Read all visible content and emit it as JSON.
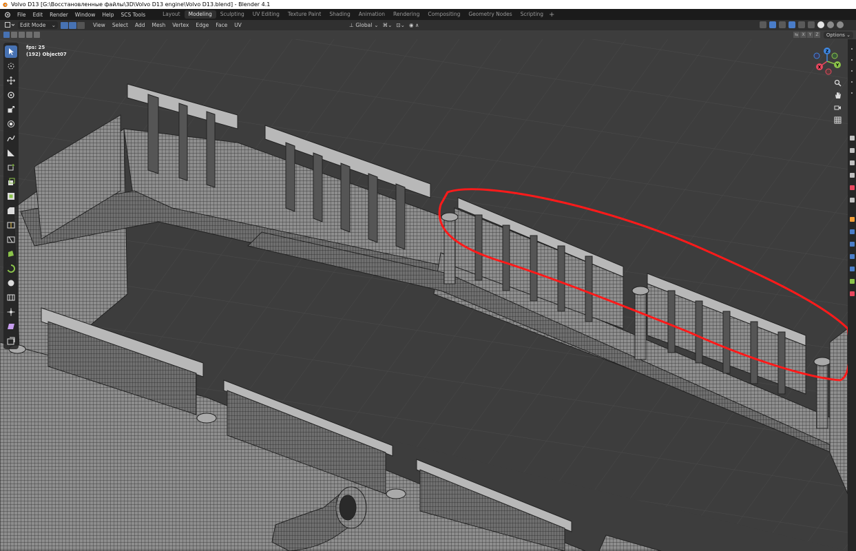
{
  "window": {
    "title": "Volvo D13 [G:\\Восстановленные файлы\\3D\\Volvo D13 engine\\Volvo D13.blend] - Blender 4.1"
  },
  "menu": {
    "items": [
      "File",
      "Edit",
      "Render",
      "Window",
      "Help",
      "SCS Tools"
    ]
  },
  "workspaces": {
    "tabs": [
      "Layout",
      "Modeling",
      "Sculpting",
      "UV Editing",
      "Texture Paint",
      "Shading",
      "Animation",
      "Rendering",
      "Compositing",
      "Geometry Nodes",
      "Scripting"
    ],
    "active": "Modeling",
    "add_label": "+"
  },
  "header": {
    "mode": "Edit Mode",
    "menus": [
      "View",
      "Select",
      "Add",
      "Mesh",
      "Vertex",
      "Edge",
      "Face",
      "UV"
    ],
    "transform_orientation": "Global"
  },
  "toolrow": {
    "axes": [
      "X",
      "Y",
      "Z"
    ],
    "options_label": "Options"
  },
  "viewport": {
    "fps": "fps: 25",
    "object_info": "(192) Object07",
    "annotation_color": "#ff1a1a",
    "background_color": "#3d3d3d",
    "mesh_color": "#8a8a8a"
  },
  "gizmo": {
    "x_color": "#e8475e",
    "y_color": "#8bc34a",
    "z_color": "#3f87e0",
    "labels": [
      "X",
      "Y",
      "Z"
    ]
  },
  "toolbar": {
    "tools": [
      "select-box",
      "cursor",
      "move",
      "rotate",
      "scale",
      "transform",
      "annotate",
      "measure",
      "add-cube",
      "extrude",
      "inset",
      "bevel",
      "loop-cut",
      "knife",
      "poly-build",
      "spin",
      "smooth",
      "edge-slide",
      "shrink",
      "shear",
      "rip"
    ]
  }
}
